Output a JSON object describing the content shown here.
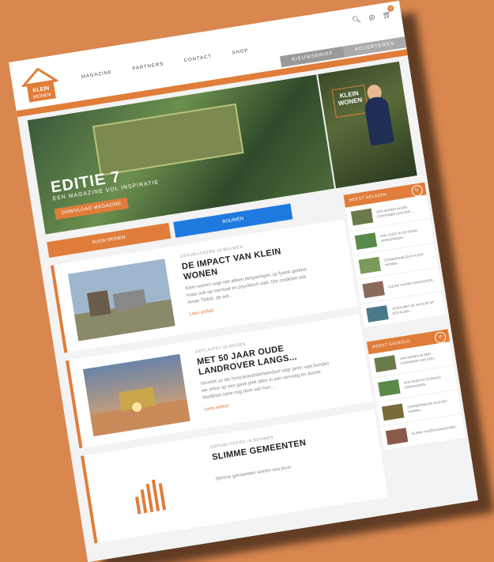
{
  "header": {
    "logo_top": "KLEIN",
    "logo_bottom": "WONEN",
    "nav": [
      "MAGAZINE",
      "PARTNERS",
      "CONTACT",
      "SHOP"
    ],
    "cart_count": "0",
    "tabs": [
      "NIEUWSBRIEF",
      "ADVERTEREN"
    ]
  },
  "hero": {
    "title": "EDITIE 7",
    "subtitle": "EEN MAGAZINE VOL INSPIRATIE",
    "button": "DOWNLOAD MAGAZINE",
    "side_logo_top": "KLEIN",
    "side_logo_bottom": "WONEN"
  },
  "filters": {
    "left": "KLEIN WONEN",
    "right": "BOUWEN"
  },
  "articles": [
    {
      "meta": "GEPUBLICEERD IN BOUWEN",
      "title": "DE IMPACT VAN KLEIN WONEN",
      "text": "Klein wonen wrgt niet alleen besparingen op fysiek gebied, maar ook op mentaal en psychisch vlak. Die ontdekte ook Annie Tibbitt, de ark...",
      "link": "Lees artikel"
    },
    {
      "meta": "GEPLAATST IN REIZEN",
      "title": "MET 50 JAAR OUDE LANDROVER LANGS...",
      "text": "Voordat ze als huiscaravanbeheerdurs uitgr jaren vast konden we zelve op een gave plek alles in een vervoeg en dunne. Marlijnse serie nog door van hun...",
      "link": "Lees artikel"
    },
    {
      "meta": "GEPUBLICEERD IN BOUWEN",
      "title": "SLIMME GEMEENTEN",
      "text": "Slimme gemeenten wonen ons jouw",
      "link": ""
    }
  ],
  "sidebar_top": {
    "heading": "MEEST GELEZEN",
    "items": [
      "DAN WONEN IN EEN CONTAINER KAN OOK...",
      "OOK GOED IN DE REGIO GRINGANDEN...",
      "ZONNEPANELEN IN KLEIN WONEN...",
      "KLEINE HUIZEN AANLEGGEN...",
      "LEVEN MET DE NATUUR OP EEN KLEIN..."
    ]
  },
  "sidebar_bottom": {
    "heading": "MEEST GEDEELD",
    "items": [
      "DAN WONEN IN EEN CONTAINER KAN OOK...",
      "OOK GOED IN DE REGIO GRINGANDEN...",
      "ZONNEPANELEN IN KLEIN WONEN...",
      "KLEINE HUIZEN AANLEGGEN..."
    ]
  },
  "colors": {
    "accent": "#e07d3a",
    "blue": "#1f7ae0",
    "background": "#d9874f"
  },
  "icons": [
    "search-icon",
    "globe-icon",
    "cart-icon",
    "refresh-icon"
  ]
}
